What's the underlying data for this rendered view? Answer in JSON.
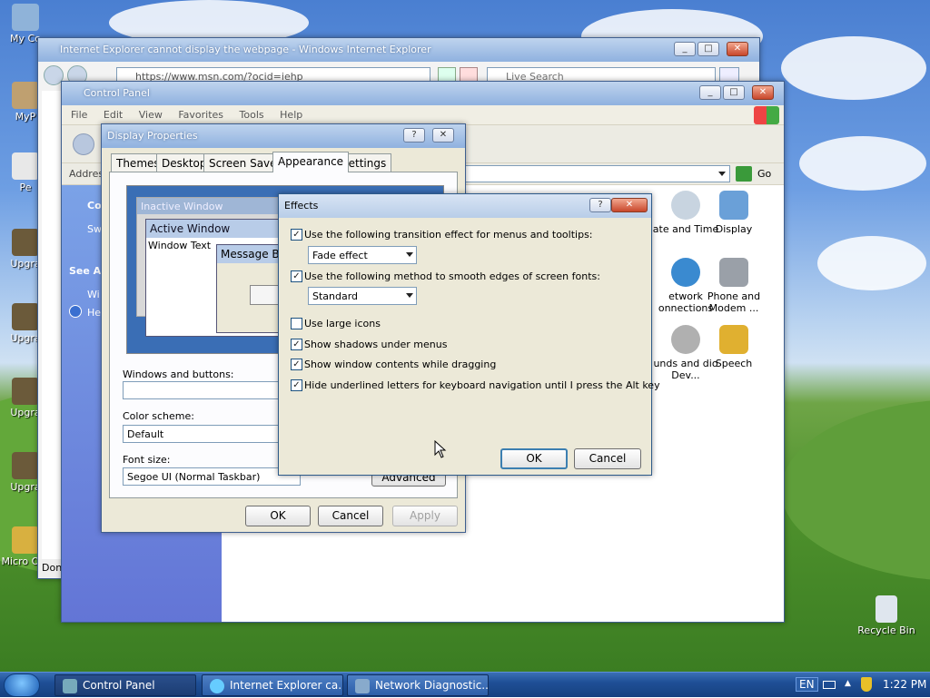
{
  "desktop": {
    "icons": [
      {
        "label": "My Co"
      },
      {
        "label": "MyP"
      },
      {
        "label": "Pe"
      },
      {
        "label": "Upgra"
      },
      {
        "label": "Upgra"
      },
      {
        "label": "Upgra"
      },
      {
        "label": "Upgra"
      },
      {
        "label": "Micro Out"
      },
      {
        "label": "Recycle Bin"
      }
    ]
  },
  "ie": {
    "title": "Internet Explorer cannot display the webpage - Windows Internet Explorer",
    "address": "https://www.msn.com/?ocid=iehp",
    "search_placeholder": "Live Search",
    "status_partial": "Don"
  },
  "cp": {
    "title": "Control Panel",
    "menu": [
      "File",
      "Edit",
      "View",
      "Favorites",
      "Tools",
      "Help"
    ],
    "address_label": "Addres",
    "go_label": "Go",
    "side": {
      "co": "Co",
      "sw": "Sw",
      "see_also": "See Als",
      "wi": "Wi",
      "he": "He"
    },
    "items": [
      {
        "label": "ate and Time"
      },
      {
        "label": "Display"
      },
      {
        "label": "etwork onnections"
      },
      {
        "label": "Phone and Modem ..."
      },
      {
        "label": "unds and dio Dev..."
      },
      {
        "label": "Speech"
      }
    ]
  },
  "dp": {
    "title": "Display Properties",
    "tabs": [
      "Themes",
      "Desktop",
      "Screen Saver",
      "Appearance",
      "Settings"
    ],
    "preview": {
      "inactive": "Inactive Window",
      "active": "Active Window",
      "window_text": "Window Text",
      "msgbox": "Message Bo"
    },
    "windows_buttons_label": "Windows and buttons:",
    "color_scheme_label": "Color scheme:",
    "color_scheme_value": "Default",
    "font_size_label": "Font size:",
    "font_size_value": "Segoe UI (Normal Taskbar)",
    "advanced_label": "Advanced",
    "ok": "OK",
    "cancel": "Cancel",
    "apply": "Apply"
  },
  "effects": {
    "title": "Effects",
    "transition_label": "Use the following transition effect for menus and tooltips:",
    "transition_value": "Fade effect",
    "smooth_label": "Use the following method to smooth edges of screen fonts:",
    "smooth_value": "Standard",
    "large_icons_label": "Use large icons",
    "shadows_label": "Show shadows under menus",
    "contents_label": "Show window contents while dragging",
    "hide_underline_label": "Hide underlined letters for keyboard navigation until I press the Alt key",
    "ok": "OK",
    "cancel": "Cancel"
  },
  "taskbar": {
    "tasks": [
      {
        "label": "Control Panel"
      },
      {
        "label": "Internet Explorer ca..."
      },
      {
        "label": "Network Diagnostic..."
      }
    ],
    "lang": "EN",
    "clock": "1:22 PM"
  }
}
